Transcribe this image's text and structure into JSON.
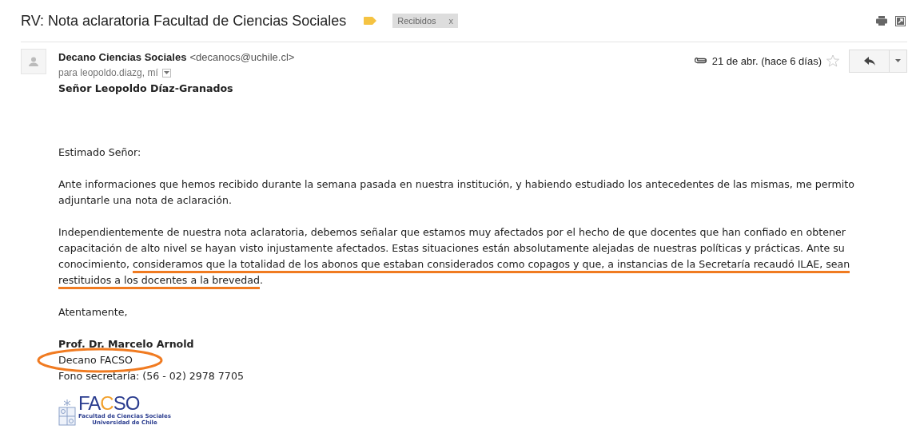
{
  "subject": "RV: Nota aclaratoria Facultad de Ciencias Sociales",
  "label": {
    "text": "Recibidos",
    "remove": "x"
  },
  "sender": {
    "name": "Decano Ciencias Sociales",
    "email": "<decanocs@uchile.cl>",
    "to": "para leopoldo.diazg, mí"
  },
  "meta": {
    "date": "21 de abr. (hace 6 días)",
    "attachment": true,
    "starred": false
  },
  "body": [
    {
      "kind": "heading",
      "segments": [
        {
          "text": "Señor Leopoldo Díaz-Granados",
          "underlined": false
        }
      ]
    },
    {
      "kind": "gap"
    },
    {
      "kind": "para",
      "segments": [
        {
          "text": "Estimado Señor:",
          "underlined": false
        }
      ]
    },
    {
      "kind": "para",
      "segments": [
        {
          "text": "Ante informaciones que hemos recibido durante la semana pasada en nuestra institución, y habiendo estudiado los antecedentes de las mismas, me permito adjuntarle una nota de aclaración.",
          "underlined": false
        }
      ]
    },
    {
      "kind": "para",
      "segments": [
        {
          "text": "Independientemente de nuestra nota aclaratoria, debemos señalar que estamos muy afectados por el hecho de que docentes que han confiado en obtener capacitación de alto nivel se hayan visto injustamente afectados. Estas situaciones están absolutamente alejadas de nuestras políticas y prácticas. Ante su conocimiento, ",
          "underlined": false
        },
        {
          "text": "consideramos que la totalidad de los abonos que estaban considerados como copagos y que, a instancias de la Secretaría recaudó ILAE, sean restituidos a los docentes a la brevedad",
          "underlined": true
        },
        {
          "text": ".",
          "underlined": false
        }
      ]
    },
    {
      "kind": "para",
      "segments": [
        {
          "text": "Atentamente,",
          "underlined": false
        }
      ]
    }
  ],
  "signature": [
    {
      "text": "Prof. Dr. Marcelo Arnold",
      "bold": true,
      "circled": false
    },
    {
      "text": "Decano FACSO",
      "bold": false,
      "circled": true
    },
    {
      "text": "Fono secretaría: (56 - 02) 2978 7705",
      "bold": false,
      "circled": false
    }
  ],
  "logo": {
    "name": "FACSO",
    "line1": "Facultad de Ciencias Sociales",
    "line2": "Universidad de Chile"
  }
}
